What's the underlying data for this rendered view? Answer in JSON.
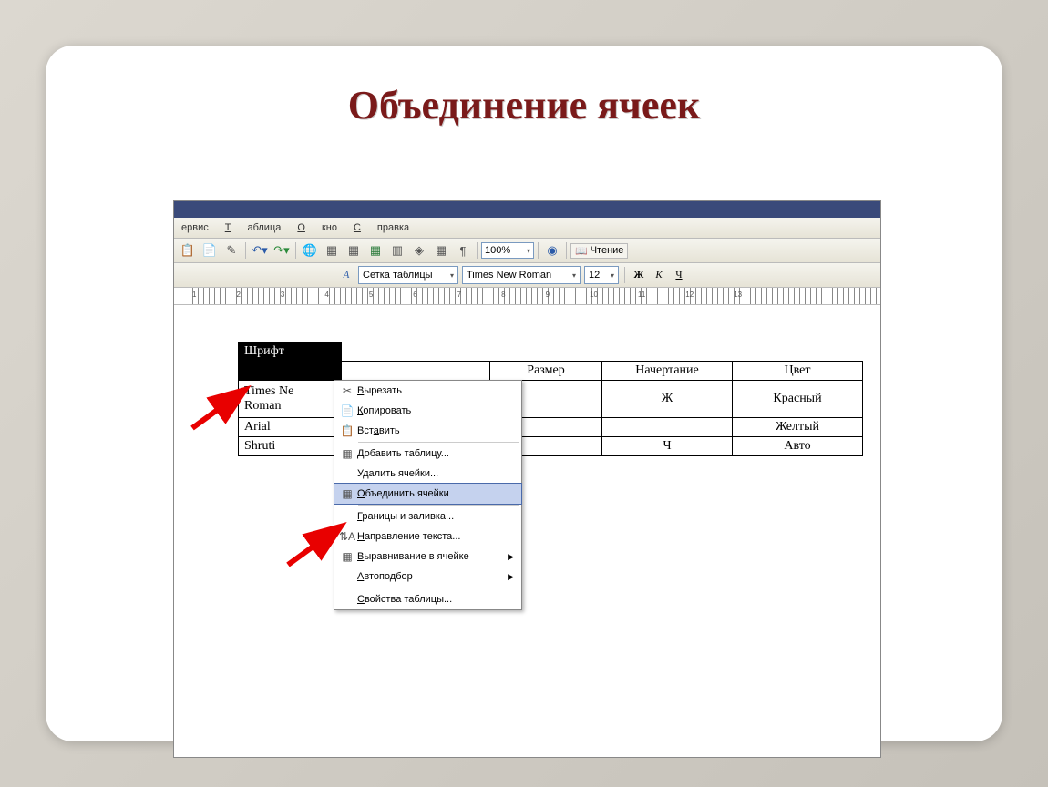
{
  "slide": {
    "title": "Объединение ячеек"
  },
  "menubar": {
    "items": [
      "ервис",
      "Таблица",
      "Окно",
      "Справка"
    ]
  },
  "toolbar": {
    "zoom": "100%",
    "reading_label": "Чтение"
  },
  "toolbar2": {
    "style_label": "Сетка таблицы",
    "font_name": "Times New Roman",
    "font_size": "12",
    "bold": "Ж",
    "italic": "К",
    "underline": "Ч"
  },
  "ruler": {
    "marks": [
      "1",
      "2",
      "3",
      "4",
      "5",
      "6",
      "7",
      "8",
      "9",
      "10",
      "11",
      "12",
      "13"
    ]
  },
  "table": {
    "rows": [
      [
        "Шрифт",
        "",
        "",
        "",
        ""
      ],
      [
        "",
        "",
        "Размер",
        "Начертание",
        "Цвет"
      ],
      [
        "Times Ne",
        "Roman",
        "",
        "Ж",
        "Красный"
      ],
      [
        "Arial",
        "",
        "",
        "",
        "Желтый"
      ],
      [
        "Shruti",
        "",
        "",
        "Ч",
        "Авто"
      ]
    ]
  },
  "context_menu": {
    "items": [
      {
        "icon": "✂",
        "label": "Вырезать",
        "u": "В"
      },
      {
        "icon": "📄",
        "label": "Копировать",
        "u": "К"
      },
      {
        "icon": "📋",
        "label": "Вставить",
        "u": "В"
      },
      {
        "hr": true
      },
      {
        "icon": "▦",
        "label": "Добавить таблицу...",
        "u": "Д"
      },
      {
        "icon": "",
        "label": "Удалить ячейки...",
        "u": ""
      },
      {
        "icon": "▦",
        "label": "Объединить ячейки",
        "u": "О",
        "highlight": true
      },
      {
        "hr": true
      },
      {
        "icon": "",
        "label": "Границы и заливка...",
        "u": "Г"
      },
      {
        "icon": "⇅",
        "label": "Направление текста...",
        "u": "Н"
      },
      {
        "icon": "▦",
        "label": "Выравнивание в ячейке",
        "u": "В",
        "sub": true
      },
      {
        "icon": "",
        "label": "Автоподбор",
        "u": "А",
        "sub": true
      },
      {
        "hr": true
      },
      {
        "icon": "",
        "label": "Свойства таблицы...",
        "u": "С"
      }
    ]
  }
}
